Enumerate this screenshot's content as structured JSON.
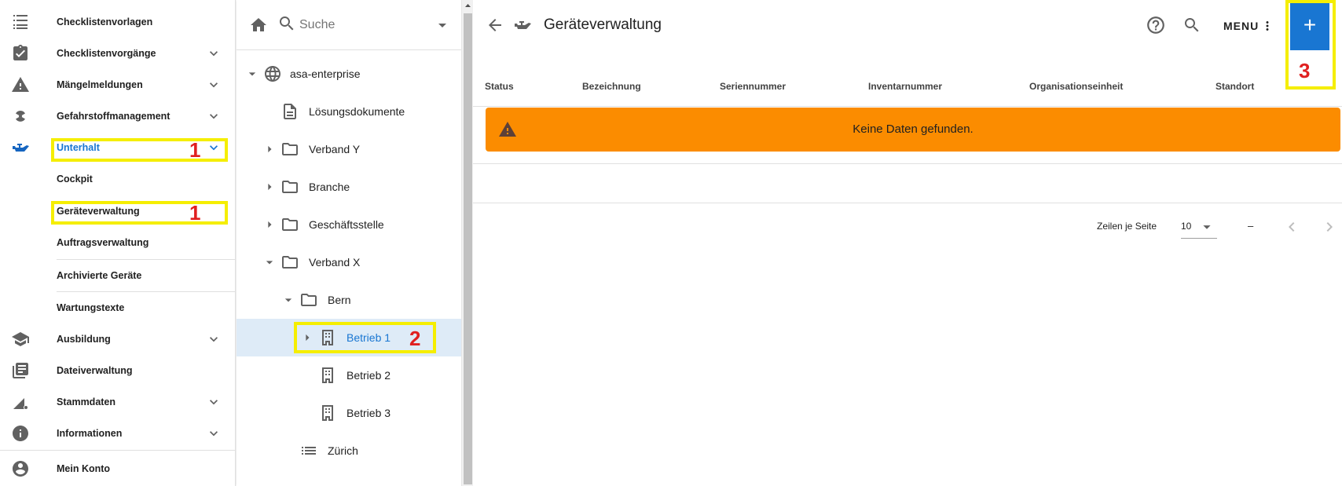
{
  "nav": {
    "items": [
      {
        "label": "Checklistenvorlagen",
        "icon": "checklist-icon"
      },
      {
        "label": "Checklistenvorgänge",
        "icon": "clipboard-check-icon"
      },
      {
        "label": "Mängelmeldungen",
        "icon": "warning-icon"
      },
      {
        "label": "Gefahrstoffmanagement",
        "icon": "radioactive-icon"
      },
      {
        "label": "Unterhalt",
        "icon": "oil-can-icon"
      },
      {
        "label": "Ausbildung",
        "icon": "graduation-cap-icon"
      },
      {
        "label": "Dateiverwaltung",
        "icon": "library-icon"
      },
      {
        "label": "Stammdaten",
        "icon": "settings-ruler-icon"
      },
      {
        "label": "Informationen",
        "icon": "info-icon"
      },
      {
        "label": "Mein Konto",
        "icon": "account-circle-icon"
      }
    ],
    "sub_items": [
      "Cockpit",
      "Geräteverwaltung",
      "Auftragsverwaltung",
      "Archivierte Geräte",
      "Wartungstexte"
    ]
  },
  "tree": {
    "search_placeholder": "Suche",
    "nodes": [
      {
        "label": "asa-enterprise",
        "icon": "globe-icon"
      },
      {
        "label": "Lösungsdokumente",
        "icon": "document-icon"
      },
      {
        "label": "Verband Y",
        "icon": "folder-icon"
      },
      {
        "label": "Branche",
        "icon": "folder-icon"
      },
      {
        "label": "Geschäftsstelle",
        "icon": "folder-icon"
      },
      {
        "label": "Verband X",
        "icon": "folder-icon"
      },
      {
        "label": "Bern",
        "icon": "folder-icon"
      },
      {
        "label": "Betrieb 1",
        "icon": "building-icon"
      },
      {
        "label": "Betrieb 2",
        "icon": "building-icon"
      },
      {
        "label": "Betrieb 3",
        "icon": "building-icon"
      },
      {
        "label": "Zürich",
        "icon": "list-icon"
      }
    ]
  },
  "main": {
    "title": "Geräteverwaltung",
    "menu_label": "MENU",
    "add_label": "+",
    "columns": [
      "Status",
      "Bezeichnung",
      "Seriennummer",
      "Inventarnummer",
      "Organisationseinheit",
      "Standort"
    ],
    "empty_message": "Keine Daten gefunden.",
    "rows_per_page_label": "Zeilen je Seite",
    "rows_per_page_value": "10",
    "range_text": "–"
  },
  "annotations": [
    "1",
    "1",
    "2",
    "3"
  ],
  "colors": {
    "accent": "#1976d2",
    "warning_banner": "#fb8c00",
    "annotation_box": "#f5ee00",
    "annotation_number": "#e02020",
    "selection": "#deebf7"
  }
}
